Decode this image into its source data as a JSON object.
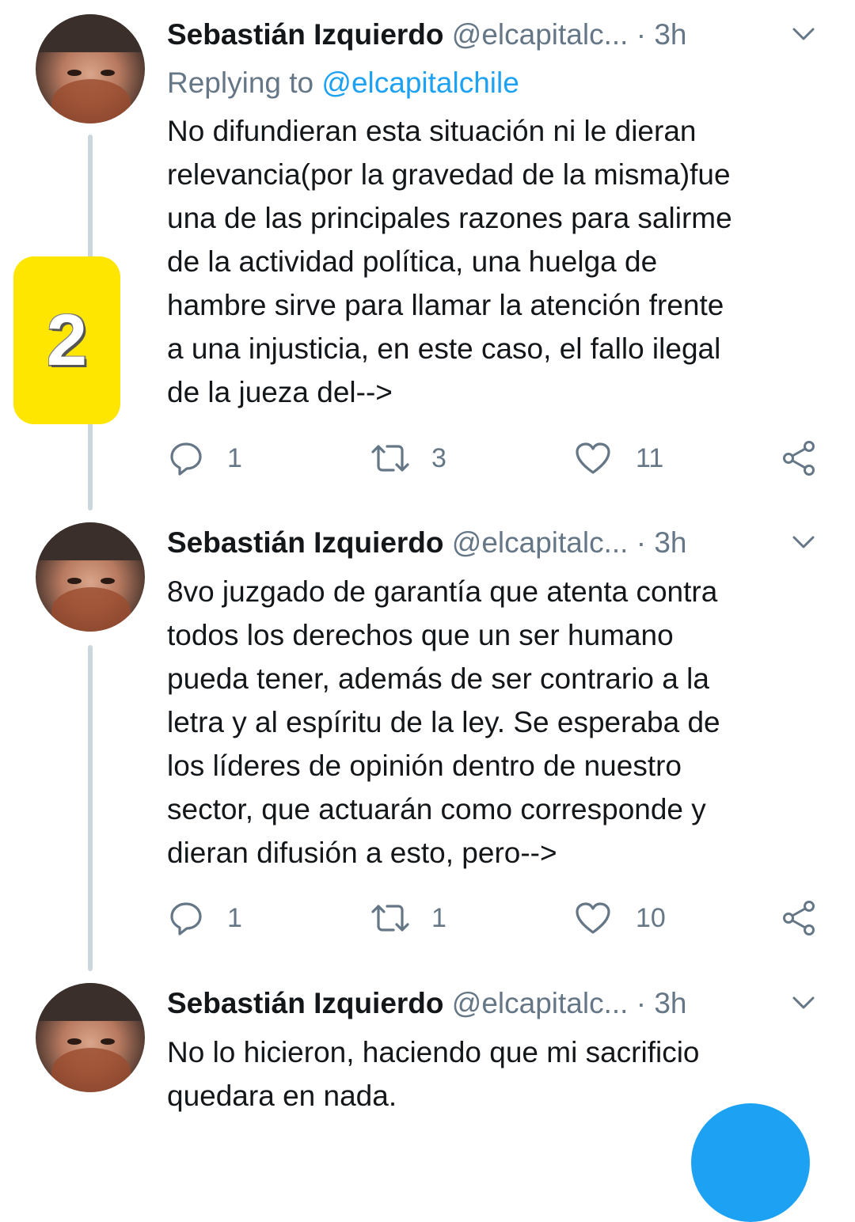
{
  "tweets": [
    {
      "name": "Sebastián Izquierdo",
      "handle": "@elcapitalc...",
      "separator": "·",
      "time": "3h",
      "replying_prefix": "Replying to ",
      "replying_to": "@elcapitalchile",
      "text": "No difundieran esta situación ni le dieran\nrelevancia(por la gravedad de la misma)fue\nuna de las principales razones para salirme\nde la actividad política, una huelga de\nhambre sirve para llamar la atención frente\na una injusticia, en este caso, el fallo ilegal\nde la jueza del-->",
      "reply_count": "1",
      "retweet_count": "3",
      "like_count": "11"
    },
    {
      "name": "Sebastián Izquierdo",
      "handle": "@elcapitalc...",
      "separator": "·",
      "time": "3h",
      "text": "8vo juzgado de garantía que atenta contra\ntodos los derechos que un ser humano\npueda tener, además de ser contrario a la\nletra y al espíritu de la ley. Se esperaba de\nlos líderes de opinión dentro de nuestro\nsector, que actuarán como corresponde y\ndieran difusión a esto, pero-->",
      "reply_count": "1",
      "retweet_count": "1",
      "like_count": "10"
    },
    {
      "name": "Sebastián Izquierdo",
      "handle": "@elcapitalc...",
      "separator": "·",
      "time": "3h",
      "text": "No lo hicieron, haciendo que mi sacrificio\nquedara en nada."
    }
  ],
  "badge": {
    "number": "2",
    "color": "#ffe600"
  },
  "colors": {
    "text": "#14171a",
    "secondary": "#657786",
    "link": "#1da1f2",
    "thread_line": "#ccd6dd"
  },
  "icons": {
    "reply": "reply-icon",
    "retweet": "retweet-icon",
    "like": "heart-icon",
    "share": "share-icon",
    "menu": "chevron-down-icon"
  }
}
